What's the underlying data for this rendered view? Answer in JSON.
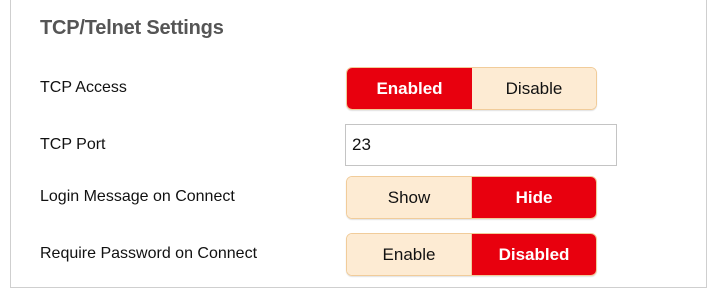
{
  "section": {
    "title": "TCP/Telnet Settings"
  },
  "tcp_access": {
    "label": "TCP Access",
    "options": [
      "Enabled",
      "Disable"
    ],
    "selected": "Enabled"
  },
  "tcp_port": {
    "label": "TCP Port",
    "value": "23"
  },
  "login_message": {
    "label": "Login Message on Connect",
    "options": [
      "Show",
      "Hide"
    ],
    "selected": "Hide"
  },
  "require_password": {
    "label": "Require Password on Connect",
    "options": [
      "Enable",
      "Disabled"
    ],
    "selected": "Disabled"
  },
  "colors": {
    "active": "#e8000e",
    "inactive": "#fdebd3",
    "title": "#555555"
  }
}
